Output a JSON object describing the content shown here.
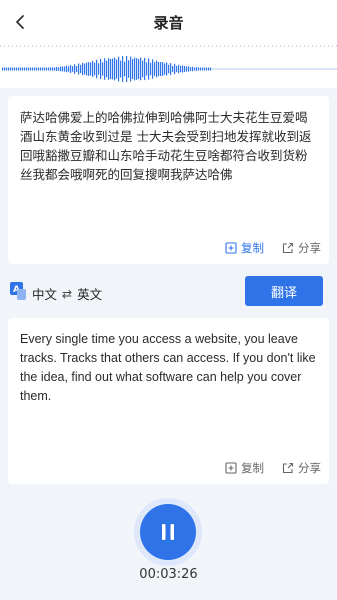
{
  "header": {
    "title": "录音"
  },
  "source": {
    "text": "萨达哈佛爱上的哈佛拉伸到哈佛阿士大夫花生豆爱喝酒山东黄金收到过是  士大夫会受到扫地发挥就收到返回哦豁撒豆瓣和山东哈手动花生豆啥都符合收到货粉丝我都会哦啊死的回复搜啊我萨达哈佛",
    "copy_label": "复制",
    "share_label": "分享"
  },
  "language": {
    "from": "中文",
    "swap": "⇄",
    "to": "英文",
    "translate_label": "翻译"
  },
  "result": {
    "text": "Every single time you access a website, you leave tracks. Tracks that others can access. If you don't like the idea, find out what software can help you cover them.",
    "copy_label": "复制",
    "share_label": "分享"
  },
  "recording": {
    "timer": "00:03:26"
  },
  "colors": {
    "accent": "#2f73e8",
    "background": "#f1f4f9"
  }
}
